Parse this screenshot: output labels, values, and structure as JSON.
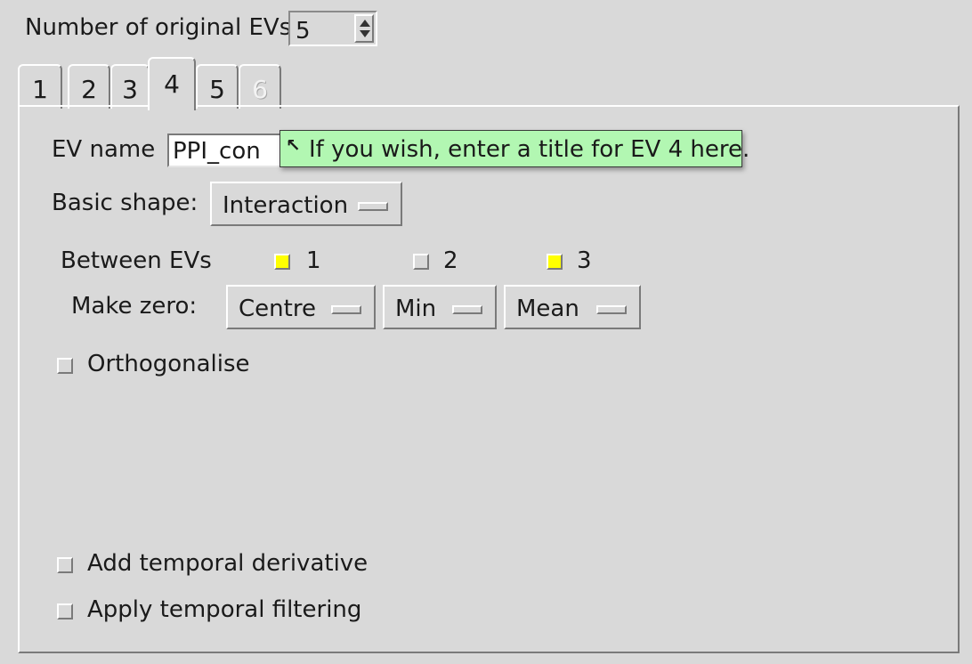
{
  "header": {
    "num_evs_label": "Number of original EVs",
    "num_evs_value": "5"
  },
  "tabs": [
    {
      "label": "1"
    },
    {
      "label": "2"
    },
    {
      "label": "3"
    },
    {
      "label": "4"
    },
    {
      "label": "5"
    },
    {
      "label": "6"
    }
  ],
  "active_tab": "4",
  "ev": {
    "name_label": "EV name",
    "name_value": "PPI_con",
    "tooltip": "If you wish, enter a title for EV 4 here.",
    "basic_shape_label": "Basic shape:",
    "basic_shape_value": "Interaction",
    "between_label": "Between EVs",
    "between": [
      {
        "label": "1",
        "checked": true
      },
      {
        "label": "2",
        "checked": false
      },
      {
        "label": "3",
        "checked": true
      }
    ],
    "make_zero_label": "Make zero:",
    "make_zero": [
      "Centre",
      "Min",
      "Mean"
    ],
    "orthogonalise_label": "Orthogonalise",
    "temporal_derivative_label": "Add temporal derivative",
    "temporal_filtering_label": "Apply temporal filtering"
  },
  "colors": {
    "background": "#d9d9d9",
    "tooltip_bg": "#b2f7b2",
    "checkbox_checked": "#ffff00"
  }
}
